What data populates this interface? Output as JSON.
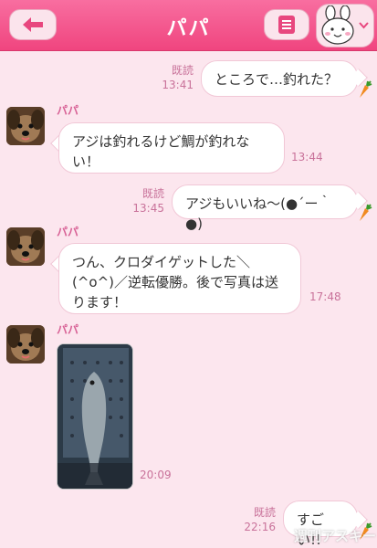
{
  "header": {
    "title": "パパ"
  },
  "colors": {
    "header": "#f0457f",
    "background": "#fce6ee",
    "meta_text": "#c9729a"
  },
  "messages": [
    {
      "side": "right",
      "text": "ところで…釣れた？",
      "read": "既読",
      "time": "13:41"
    },
    {
      "side": "left",
      "sender": "パパ",
      "text": "アジは釣れるけど鯛が釣れない！",
      "time": "13:44"
    },
    {
      "side": "right",
      "text": "アジもいいね〜(●´ー｀●)",
      "read": "既読",
      "time": "13:45"
    },
    {
      "side": "left",
      "sender": "パパ",
      "text": "つん、クロダイゲットした＼(^o^)／逆転優勝。後で写真は送ります！",
      "time": "17:48"
    },
    {
      "side": "left",
      "sender": "パパ",
      "type": "photo",
      "time": "20:09"
    },
    {
      "side": "right",
      "text": "すごい!!",
      "read": "既読",
      "time": "22:16"
    }
  ],
  "watermark": "週刊アスキー",
  "icons": [
    "back-arrow-icon",
    "menu-icon",
    "bear-sticker-icon",
    "chevron-down-icon",
    "carrot-icon"
  ]
}
